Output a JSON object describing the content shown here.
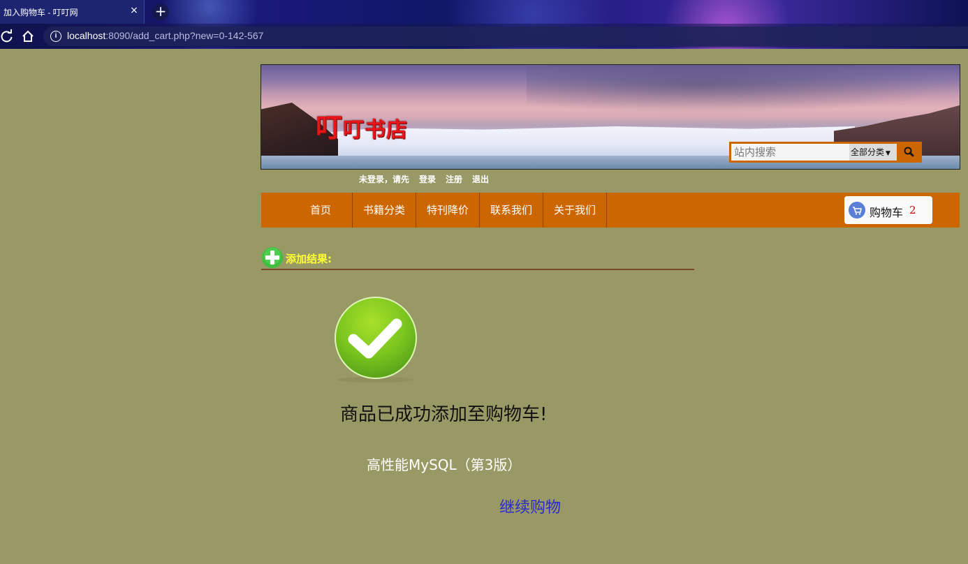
{
  "browser": {
    "tab_title": "加入购物车 - 叮叮网",
    "tab_close": "×",
    "new_tab": "+",
    "url_host": "localhost",
    "url_rest": ":8090/add_cart.php?new=0-142-567"
  },
  "header": {
    "logo_first": "叮",
    "logo_rest": "叮书店",
    "search": {
      "placeholder": "站内搜索",
      "category": "全部分类"
    }
  },
  "login_bar": {
    "status": "未登录，请先",
    "login": "登录",
    "register": "注册",
    "logout": "退出"
  },
  "nav": {
    "items": [
      "首页",
      "书籍分类",
      "特刊降价",
      "联系我们",
      "关于我们"
    ],
    "cart_label": "购物车",
    "cart_count": "2"
  },
  "result": {
    "title": "添加结果:",
    "message": "商品已成功添加至购物车!",
    "book": "高性能MySQL（第3版）",
    "continue": "继续购物"
  },
  "colors": {
    "page_bg": "#999966",
    "nav_bg": "#cc6600",
    "result_title": "#ffff33",
    "continue_link": "#2a2acc",
    "cart_count": "#cc0000"
  }
}
